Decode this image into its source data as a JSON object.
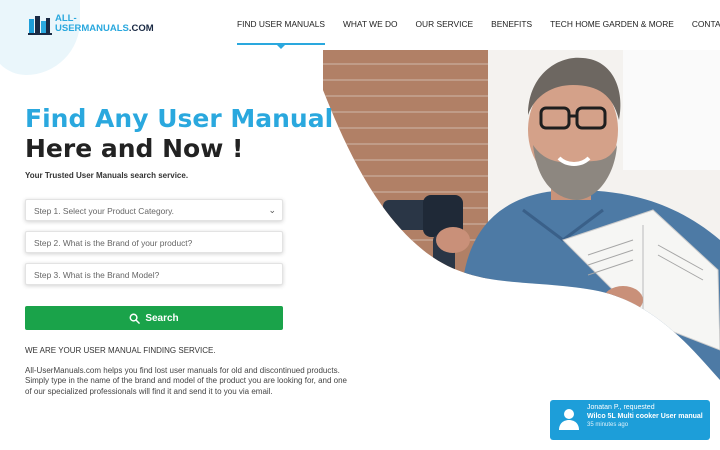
{
  "logo": {
    "line1": "ALL-",
    "line2": "USERMANUALS",
    "domain": ".COM"
  },
  "nav": {
    "items": [
      {
        "label": "FIND USER MANUALS",
        "active": true
      },
      {
        "label": "WHAT WE DO"
      },
      {
        "label": "OUR SERVICE"
      },
      {
        "label": "BENEFITS"
      },
      {
        "label": "TECH HOME GARDEN & MORE"
      },
      {
        "label": "CONTACT US"
      }
    ]
  },
  "hero": {
    "title_line1": "Find Any User Manual",
    "title_line2": "Here and Now !",
    "tagline": "Your Trusted User Manuals search service."
  },
  "form": {
    "step1": "Step 1. Select your Product Category.",
    "step2": "Step 2. What is the Brand of your product?",
    "step3": "Step 3. What is the Brand Model?",
    "search_label": "Search"
  },
  "about": {
    "headline": "WE ARE YOUR USER MANUAL FINDING SERVICE.",
    "description": "All-UserManuals.com helps you find lost user manuals for old and discontinued products. Simply type in the name of the brand and model of the product you are looking for, and one of our specialized professionals will find it and send it to you via email."
  },
  "notification": {
    "name": "Jonatan P., requested",
    "message": "Wilco 5L Multi cooker User manual",
    "time": "35 minutes ago"
  },
  "colors": {
    "accent": "#2aa8de",
    "button": "#1aa34a",
    "toast": "#1d9ed9",
    "dark": "#1a2a44"
  },
  "icons": {
    "logo": "book-stack-icon",
    "search": "search-icon",
    "user": "user-icon",
    "select": "chevron-down-icon"
  }
}
